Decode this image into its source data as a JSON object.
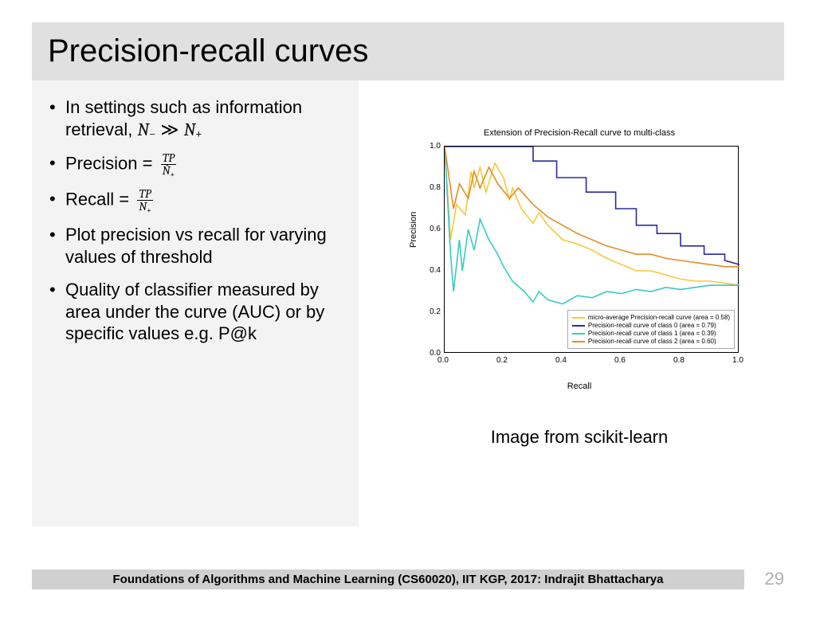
{
  "title": "Precision-recall curves",
  "bullets": {
    "b1_pre": "In settings such as information retrieval, ",
    "b2_pre": "Precision = ",
    "b3_pre": "Recall = ",
    "b4": "Plot precision vs recall for varying values of threshold",
    "b5": "Quality of classifier measured by area under the curve (AUC) or by specific values e.g. P@k"
  },
  "math": {
    "Nminus": "N",
    "minus": "−",
    "Nplus": "N",
    "plus": "+",
    "Nhatplus": "N̂",
    "gg": "≫",
    "TP": "TP"
  },
  "chart_data": {
    "type": "line",
    "title": "Extension of Precision-Recall curve to multi-class",
    "xlabel": "Recall",
    "ylabel": "Precision",
    "xlim": [
      0.0,
      1.0
    ],
    "ylim": [
      0.0,
      1.0
    ],
    "xticks": [
      0.0,
      0.2,
      0.4,
      0.6,
      0.8,
      1.0
    ],
    "yticks": [
      0.0,
      0.2,
      0.4,
      0.6,
      0.8,
      1.0
    ],
    "legend_position": "lower-right",
    "series": [
      {
        "name": "micro-average Precision-recall curve (area = 0.58)",
        "color": "#f5c93a",
        "x": [
          0.0,
          0.02,
          0.04,
          0.07,
          0.09,
          0.1,
          0.12,
          0.14,
          0.17,
          0.2,
          0.22,
          0.23,
          0.26,
          0.3,
          0.32,
          0.35,
          0.4,
          0.45,
          0.5,
          0.55,
          0.6,
          0.65,
          0.7,
          0.75,
          0.8,
          0.85,
          0.9,
          0.95,
          1.0
        ],
        "y": [
          1.0,
          0.55,
          0.72,
          0.67,
          0.88,
          0.8,
          0.9,
          0.78,
          0.92,
          0.85,
          0.74,
          0.8,
          0.7,
          0.63,
          0.68,
          0.62,
          0.55,
          0.53,
          0.5,
          0.46,
          0.43,
          0.4,
          0.4,
          0.38,
          0.36,
          0.35,
          0.35,
          0.34,
          0.33
        ]
      },
      {
        "name": "Precision-recall curve of class 0 (area = 0.79)",
        "color": "#2a2aa0",
        "x": [
          0.0,
          0.05,
          0.08,
          0.12,
          0.18,
          0.24,
          0.3,
          0.3,
          0.38,
          0.38,
          0.48,
          0.48,
          0.58,
          0.58,
          0.65,
          0.65,
          0.72,
          0.72,
          0.8,
          0.8,
          0.88,
          0.88,
          0.95,
          0.95,
          1.0
        ],
        "y": [
          1.0,
          1.0,
          1.0,
          1.0,
          1.0,
          1.0,
          1.0,
          0.93,
          0.93,
          0.85,
          0.85,
          0.78,
          0.78,
          0.7,
          0.7,
          0.62,
          0.62,
          0.58,
          0.58,
          0.52,
          0.52,
          0.48,
          0.48,
          0.45,
          0.43
        ]
      },
      {
        "name": "Precision-recall curve of class 1 (area = 0.39)",
        "color": "#3ac8c8",
        "x": [
          0.0,
          0.02,
          0.03,
          0.05,
          0.06,
          0.08,
          0.1,
          0.12,
          0.15,
          0.18,
          0.2,
          0.23,
          0.27,
          0.3,
          0.32,
          0.35,
          0.4,
          0.45,
          0.5,
          0.55,
          0.6,
          0.65,
          0.7,
          0.75,
          0.8,
          0.85,
          0.9,
          0.95,
          1.0
        ],
        "y": [
          1.0,
          0.48,
          0.3,
          0.55,
          0.4,
          0.6,
          0.5,
          0.65,
          0.55,
          0.48,
          0.42,
          0.35,
          0.3,
          0.25,
          0.3,
          0.26,
          0.24,
          0.28,
          0.27,
          0.3,
          0.29,
          0.31,
          0.3,
          0.32,
          0.31,
          0.32,
          0.33,
          0.33,
          0.33
        ]
      },
      {
        "name": "Precision-recall curve of class 2 (area = 0.60)",
        "color": "#e38d27",
        "x": [
          0.0,
          0.03,
          0.05,
          0.08,
          0.1,
          0.12,
          0.15,
          0.18,
          0.22,
          0.25,
          0.3,
          0.35,
          0.4,
          0.45,
          0.5,
          0.55,
          0.6,
          0.65,
          0.7,
          0.75,
          0.8,
          0.85,
          0.9,
          0.95,
          1.0
        ],
        "y": [
          1.0,
          0.7,
          0.82,
          0.75,
          0.88,
          0.8,
          0.9,
          0.82,
          0.75,
          0.8,
          0.72,
          0.66,
          0.62,
          0.58,
          0.55,
          0.52,
          0.5,
          0.48,
          0.48,
          0.46,
          0.45,
          0.44,
          0.43,
          0.42,
          0.42
        ]
      }
    ]
  },
  "caption": "Image from scikit-learn",
  "footer": "Foundations of Algorithms and Machine Learning (CS60020), IIT KGP, 2017: Indrajit Bhattacharya",
  "page": "29"
}
